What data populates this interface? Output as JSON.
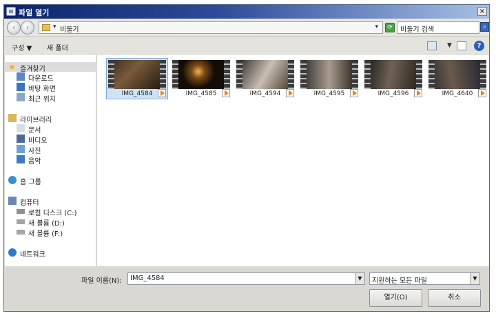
{
  "window": {
    "title": "파일 열기",
    "close_label": "×"
  },
  "nav": {
    "back_label": "‹",
    "forward_label": "›",
    "address": "비둘기",
    "search_placeholder": "비둘기 검색"
  },
  "toolbar": {
    "organize": "구성 ▼",
    "new_folder": "새 폴더",
    "help": "?"
  },
  "sidebar": {
    "favorites": {
      "header": "즐겨찾기",
      "items": [
        "다운로드",
        "바탕 화면",
        "최근 위치"
      ]
    },
    "libraries": {
      "header": "라이브러리",
      "items": [
        "문서",
        "비디오",
        "사진",
        "음악"
      ]
    },
    "homegroup": "홈 그룹",
    "computer": {
      "header": "컴퓨터",
      "items": [
        "로컬 디스크 (C:)",
        "새 볼륨 (D:)",
        "새 볼륨 (F:)"
      ]
    },
    "network": "네트워크"
  },
  "files": [
    {
      "name": "IMG_4584",
      "selected": true
    },
    {
      "name": "IMG_4585"
    },
    {
      "name": "IMG_4594"
    },
    {
      "name": "IMG_4595"
    },
    {
      "name": "IMG_4596"
    },
    {
      "name": "IMG_4640"
    }
  ],
  "footer": {
    "filename_label": "파일 이름(N):",
    "filename_value": "IMG_4584",
    "filetype_value": "지원하는 모든 파일",
    "open_button": "열기(O)",
    "cancel_button": "취소"
  },
  "colors": {
    "selection": "#cde4f7",
    "title_bar": "#0c246a",
    "play_icon": "#e77e17"
  }
}
